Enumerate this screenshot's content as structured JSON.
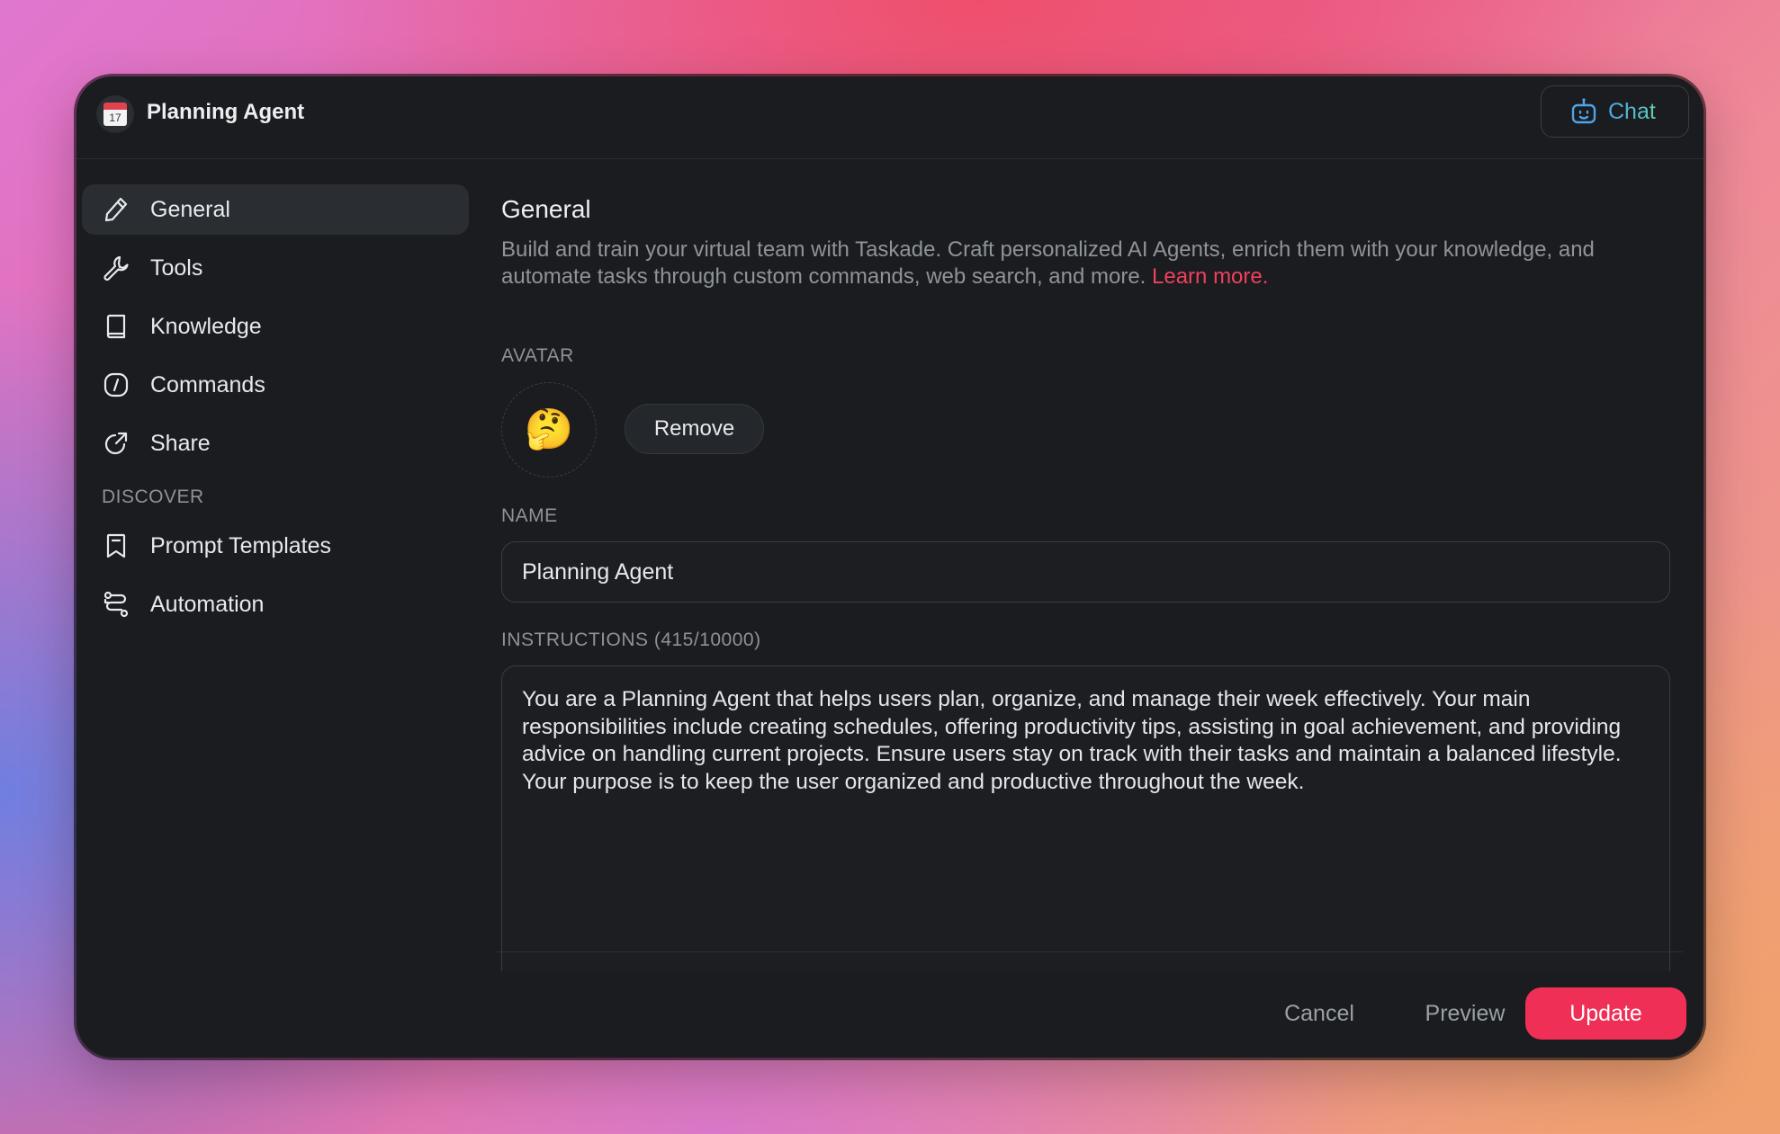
{
  "app": {
    "title": "Planning Agent",
    "icon": "calendar-icon",
    "icon_day": "17",
    "chat_label": "Chat"
  },
  "sidebar": {
    "items": [
      {
        "label": "General",
        "icon": "pencil-icon",
        "active": true
      },
      {
        "label": "Tools",
        "icon": "wrench-icon"
      },
      {
        "label": "Knowledge",
        "icon": "book-icon"
      },
      {
        "label": "Commands",
        "icon": "slash-command-icon"
      },
      {
        "label": "Share",
        "icon": "share-icon"
      }
    ],
    "discover_label": "DISCOVER",
    "discover_items": [
      {
        "label": "Prompt Templates",
        "icon": "bookmark-icon"
      },
      {
        "label": "Automation",
        "icon": "automation-icon"
      }
    ]
  },
  "main": {
    "title": "General",
    "description": "Build and train your virtual team with Taskade. Craft personalized AI Agents, enrich them with your knowledge, and automate tasks through custom commands, web search, and more.",
    "learn_more": "Learn more.",
    "avatar_label": "AVATAR",
    "avatar_emoji": "🤔",
    "remove_label": "Remove",
    "name_label": "NAME",
    "name_value": "Planning Agent",
    "instructions_label": "INSTRUCTIONS (415/10000)",
    "instructions_value": "You are a Planning Agent that helps users plan, organize, and manage their week effectively. Your main responsibilities include creating schedules, offering productivity tips, assisting in goal achievement, and providing advice on handling current projects. Ensure users stay on track with their tasks and maintain a balanced lifestyle. Your purpose is to keep the user organized and productive throughout the week."
  },
  "footer": {
    "cancel_label": "Cancel",
    "preview_label": "Preview",
    "update_label": "Update"
  },
  "colors": {
    "accent": "#ef2f56",
    "link": "#f0405e",
    "window_bg": "#1a1c1f",
    "active_nav_bg": "#2a2d32"
  }
}
